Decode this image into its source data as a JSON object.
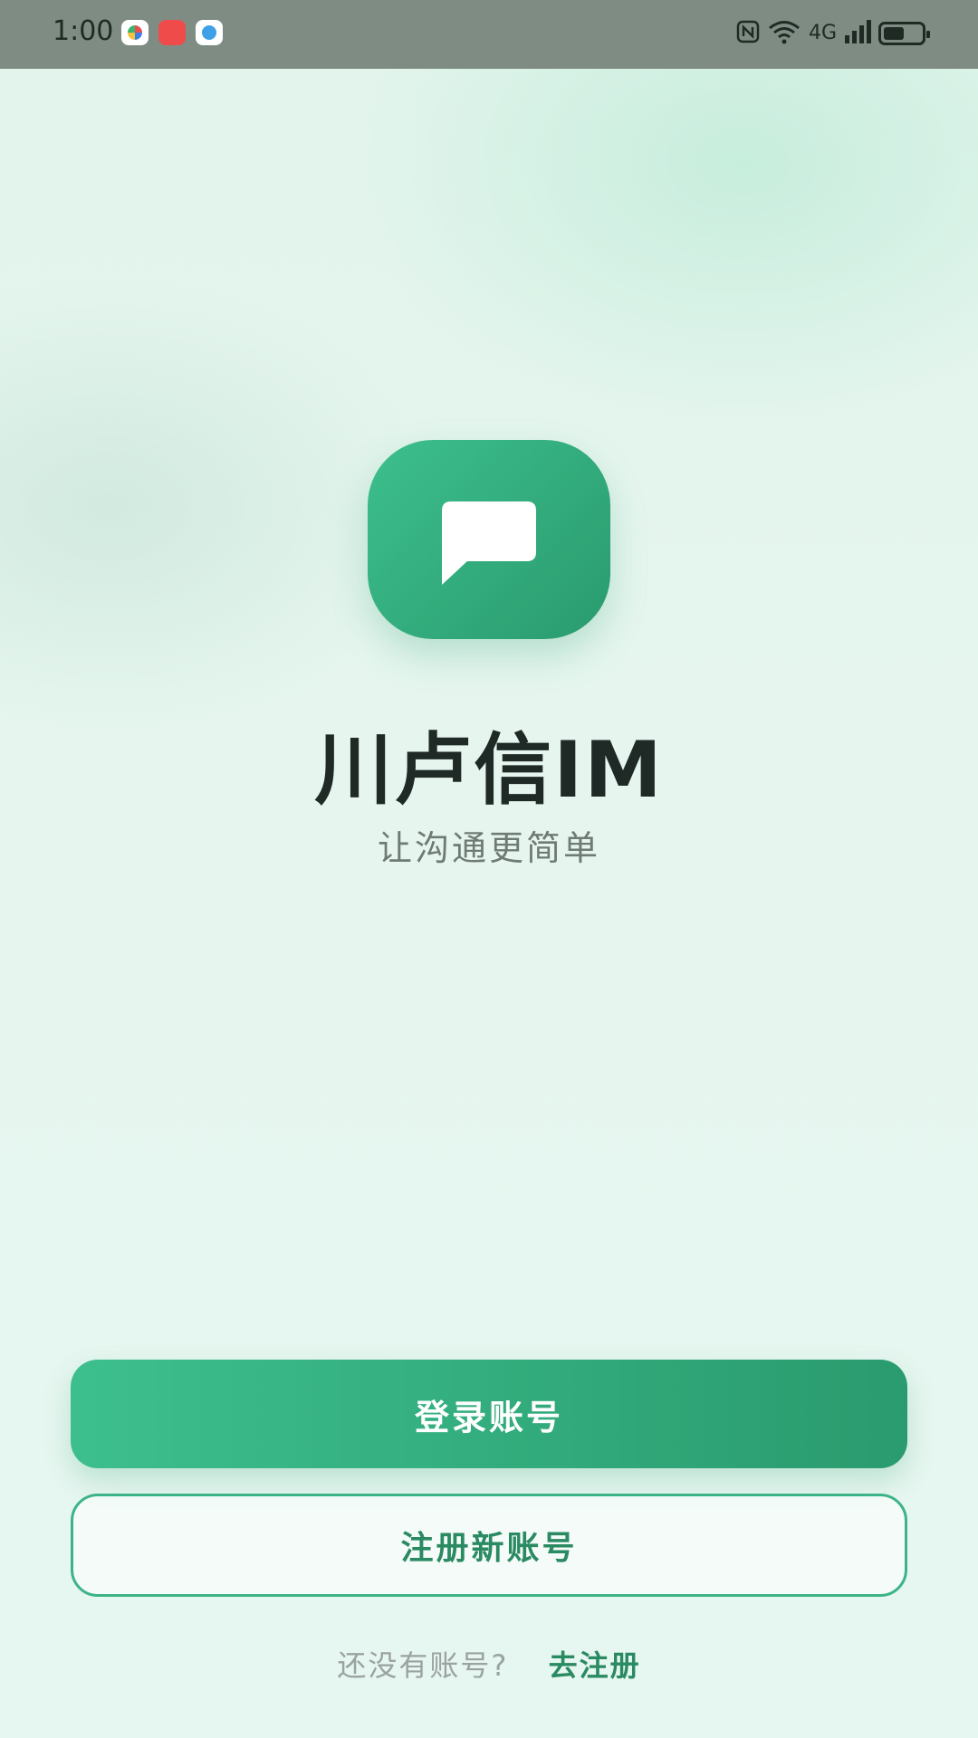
{
  "status_bar": {
    "time": "1:00",
    "apps": [
      "app-icon-1",
      "app-icon-2",
      "app-icon-3"
    ],
    "right_icons": [
      "nfc-icon",
      "wifi-icon",
      "cellular-4g-icon",
      "battery-icon"
    ],
    "network_label": "4G",
    "battery_level": 0.55
  },
  "logo": {
    "icon": "chat-bubble-icon",
    "colors": [
      "#3dbf8d",
      "#2a9b6e"
    ]
  },
  "title": "川卢信IM",
  "slogan": "让沟通更简单",
  "buttons": {
    "login": "登录账号",
    "register": "注册新账号"
  },
  "footer": {
    "prompt": "还没有账号?",
    "link": "去注册"
  },
  "colors": {
    "accent": "#2a9b6e",
    "accent_light": "#3dbf8d",
    "background": "#e4f5ed",
    "status_bar": "#7f8c84"
  }
}
